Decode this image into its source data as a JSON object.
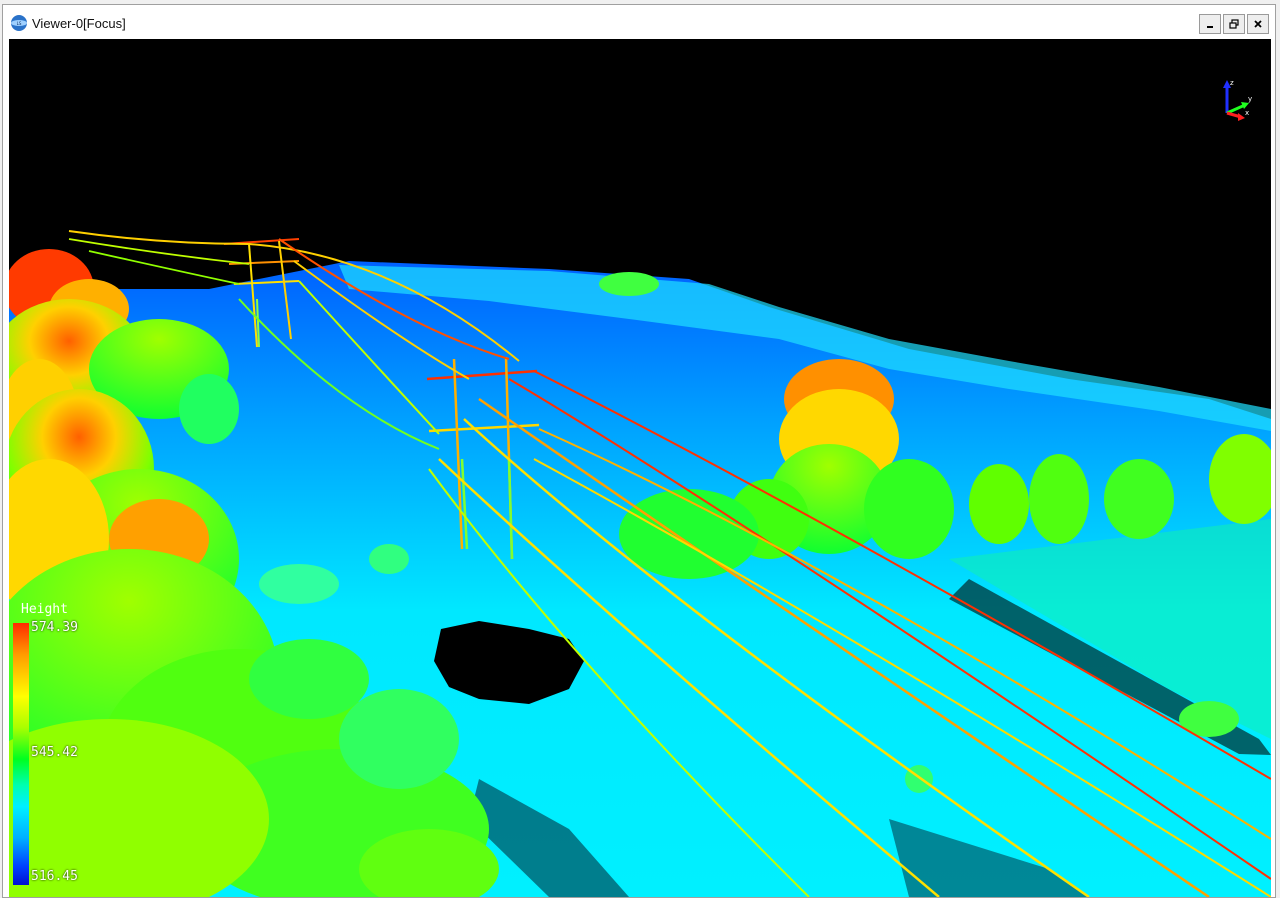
{
  "window": {
    "title": "Viewer-0[Focus]"
  },
  "title_buttons": {
    "minimize_icon": "minimize-icon",
    "restore_icon": "restore-icon",
    "close_icon": "close-icon"
  },
  "legend": {
    "title": "Height",
    "max": "574.39",
    "mid": "545.42",
    "min": "516.45"
  },
  "axes": {
    "z": "z",
    "y": "y",
    "x": "x"
  },
  "colors": {
    "background": "#000000",
    "ground": "#00e6ff",
    "vegetation": "#22ff00",
    "high": "#ff3000",
    "mid_high": "#ffff00",
    "low": "#0050ff"
  }
}
